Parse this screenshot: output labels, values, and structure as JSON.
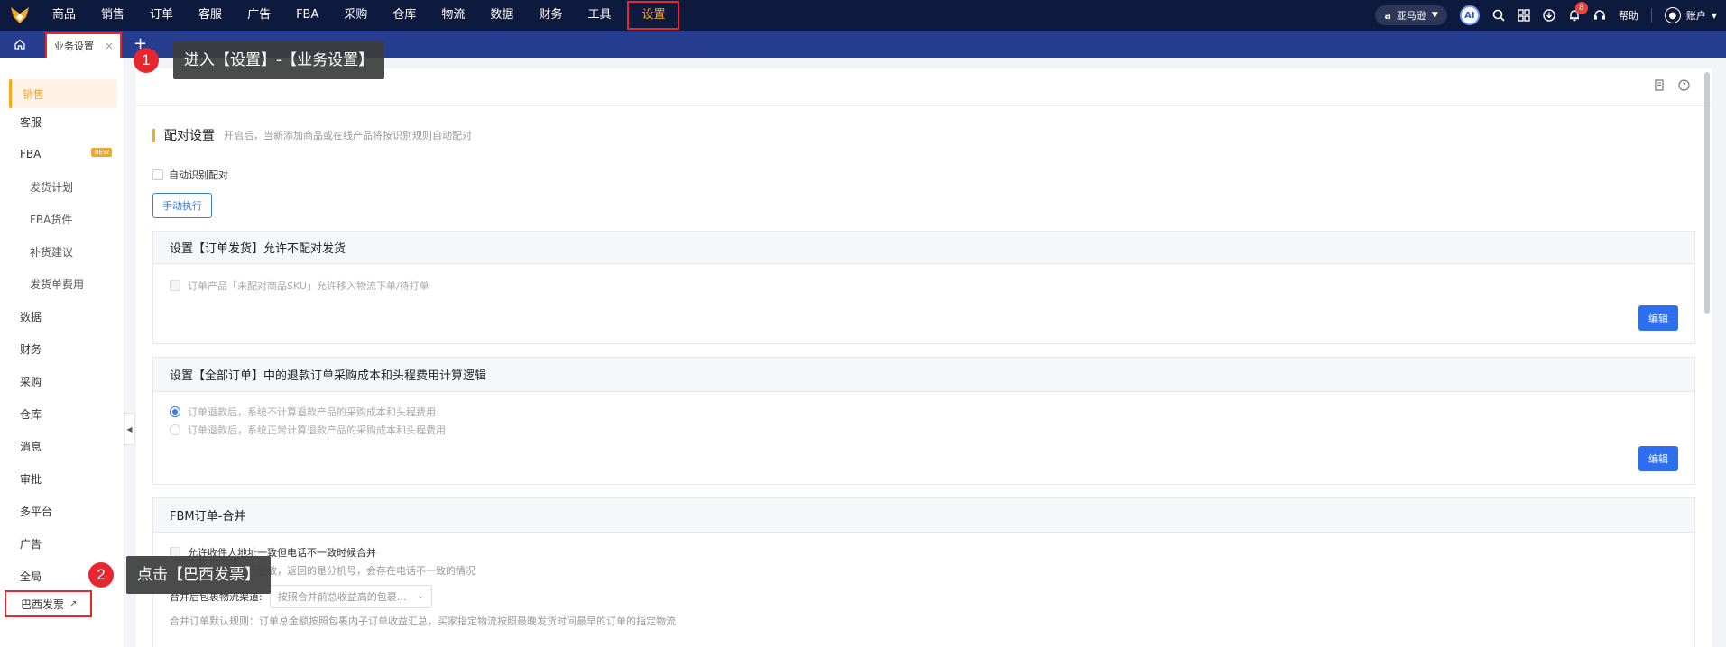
{
  "nav": {
    "items": [
      "商品",
      "销售",
      "订单",
      "客服",
      "广告",
      "FBA",
      "采购",
      "仓库",
      "物流",
      "数据",
      "财务",
      "工具",
      "设置"
    ],
    "active_index": 12,
    "region": "亚马逊",
    "ai_label": "AI",
    "notification_count": "8",
    "help": "帮助",
    "account": "账户"
  },
  "tabs": {
    "current": "业务设置",
    "close": "×",
    "add": "+"
  },
  "annotations": {
    "step1_number": "1",
    "step1_text": "进入【设置】-【业务设置】",
    "step2_number": "2",
    "step2_text": "点击【巴西发票】"
  },
  "sidebar": {
    "items": [
      {
        "label": "销售",
        "active": true
      },
      {
        "label": "客服"
      },
      {
        "label": "FBA",
        "badge": "NEW"
      },
      {
        "label": "发货计划",
        "sub": true
      },
      {
        "label": "FBA货件",
        "sub": true
      },
      {
        "label": "补货建议",
        "sub": true
      },
      {
        "label": "发货单费用",
        "sub": true
      },
      {
        "label": "数据"
      },
      {
        "label": "财务"
      },
      {
        "label": "采购"
      },
      {
        "label": "仓库"
      },
      {
        "label": "消息"
      },
      {
        "label": "审批"
      },
      {
        "label": "多平台"
      },
      {
        "label": "广告"
      },
      {
        "label": "全局"
      },
      {
        "label": "巴西发票",
        "external": true
      }
    ]
  },
  "main": {
    "section_title": "配对设置",
    "section_desc": "开启后，当新添加商品或在线产品将按识别规则自动配对",
    "auto_match_label": "自动识别配对",
    "manual_button": "手动执行",
    "panel1": {
      "title": "设置【订单发货】允许不配对发货",
      "option": "订单产品「未配对商品SKU」允许移入物流下单/待打单",
      "edit": "编辑"
    },
    "panel2": {
      "title": "设置【全部订单】中的退款订单采购成本和头程费用计算逻辑",
      "option1": "订单退款后，系统不计算退款产品的采购成本和头程费用",
      "option2": "订单退款后，系统正常计算退款产品的采购成本和头程费用",
      "edit": "编辑"
    },
    "panel3": {
      "title": "FBM订单-合并",
      "option1": "允许收件人地址一致但电话不一致时候合并",
      "option1_note": "收件人电话进行脱敏，返回的是分机号，会存在电话不一致的情况",
      "channel_label": "合并后包裹物流渠道:",
      "channel_value": "按照合并前总收益高的包裹的物流",
      "rule_text": "合并订单默认规则：订单总金额按照包裹内子订单收益汇总，买家指定物流按照最晚发货时间最早的订单的指定物流"
    }
  }
}
